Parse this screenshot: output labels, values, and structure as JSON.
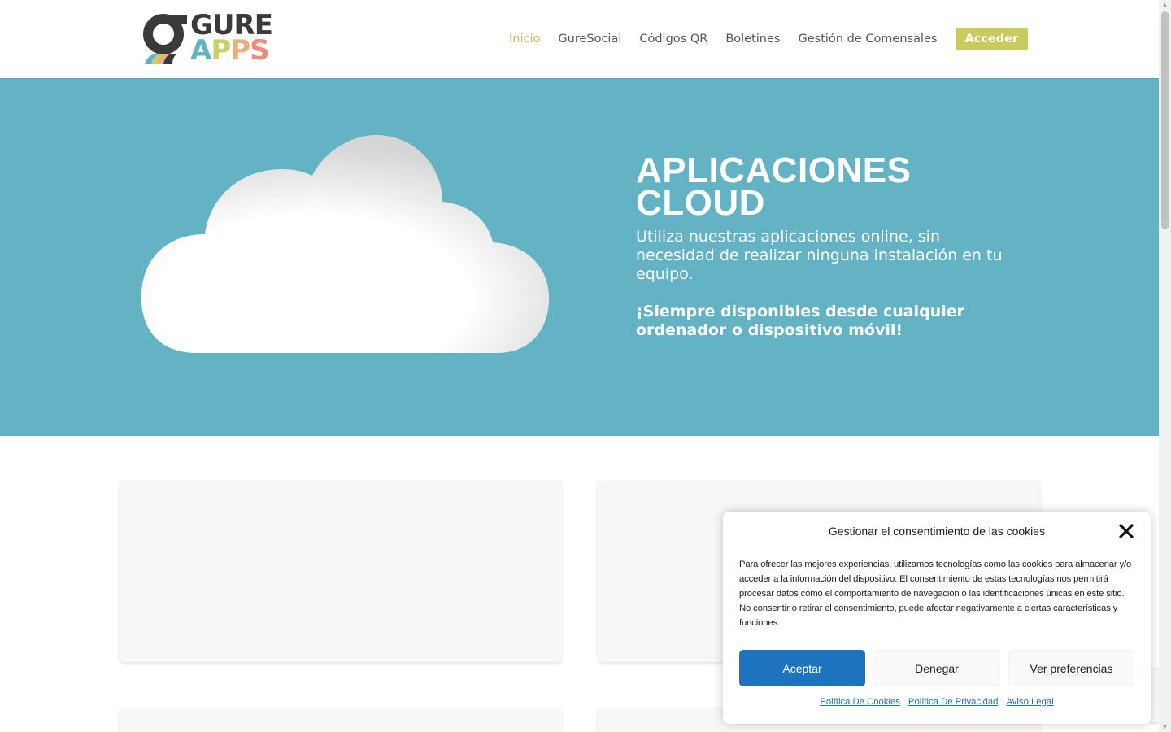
{
  "header": {
    "logo": {
      "line1": "GURE",
      "line2": [
        "A",
        "P",
        "P",
        "S"
      ]
    },
    "nav": [
      {
        "label": "Inicio",
        "active": true
      },
      {
        "label": "GureSocial"
      },
      {
        "label": "Códigos QR"
      },
      {
        "label": "Boletines"
      },
      {
        "label": "Gestión de Comensales"
      }
    ],
    "cta_label": "Acceder"
  },
  "hero": {
    "title": "APLICACIONES CLOUD",
    "subtitle": "Utiliza nuestras aplicaciones online, sin necesidad de realizar ninguna instalación en tu equipo.",
    "highlight": "¡Siempre disponibles desde cualquier ordenador o dispositivo móvil!",
    "image_icon": "cloud-illustration"
  },
  "cookie_dialog": {
    "title": "Gestionar el consentimiento de las cookies",
    "text": "Para ofrecer las mejores experiencias, utilizamos tecnologías como las cookies para almacenar y/o acceder a la información del dispositivo. El consentimiento de estas tecnologías nos permitirá procesar datos como el comportamiento de navegación o las identificaciones únicas en este sitio. No consentir o retirar el consentimiento, puede afectar negativamente a ciertas características y funciones.",
    "accept_label": "Aceptar",
    "deny_label": "Denegar",
    "prefs_label": "Ver preferencias",
    "links": [
      "Política De Cookies",
      "Política De Privacidad",
      "Aviso Legal"
    ]
  },
  "colors": {
    "hero_bg": "#63b3c4",
    "accent_green": "#c9cc5c",
    "accept_blue": "#1e73be"
  }
}
